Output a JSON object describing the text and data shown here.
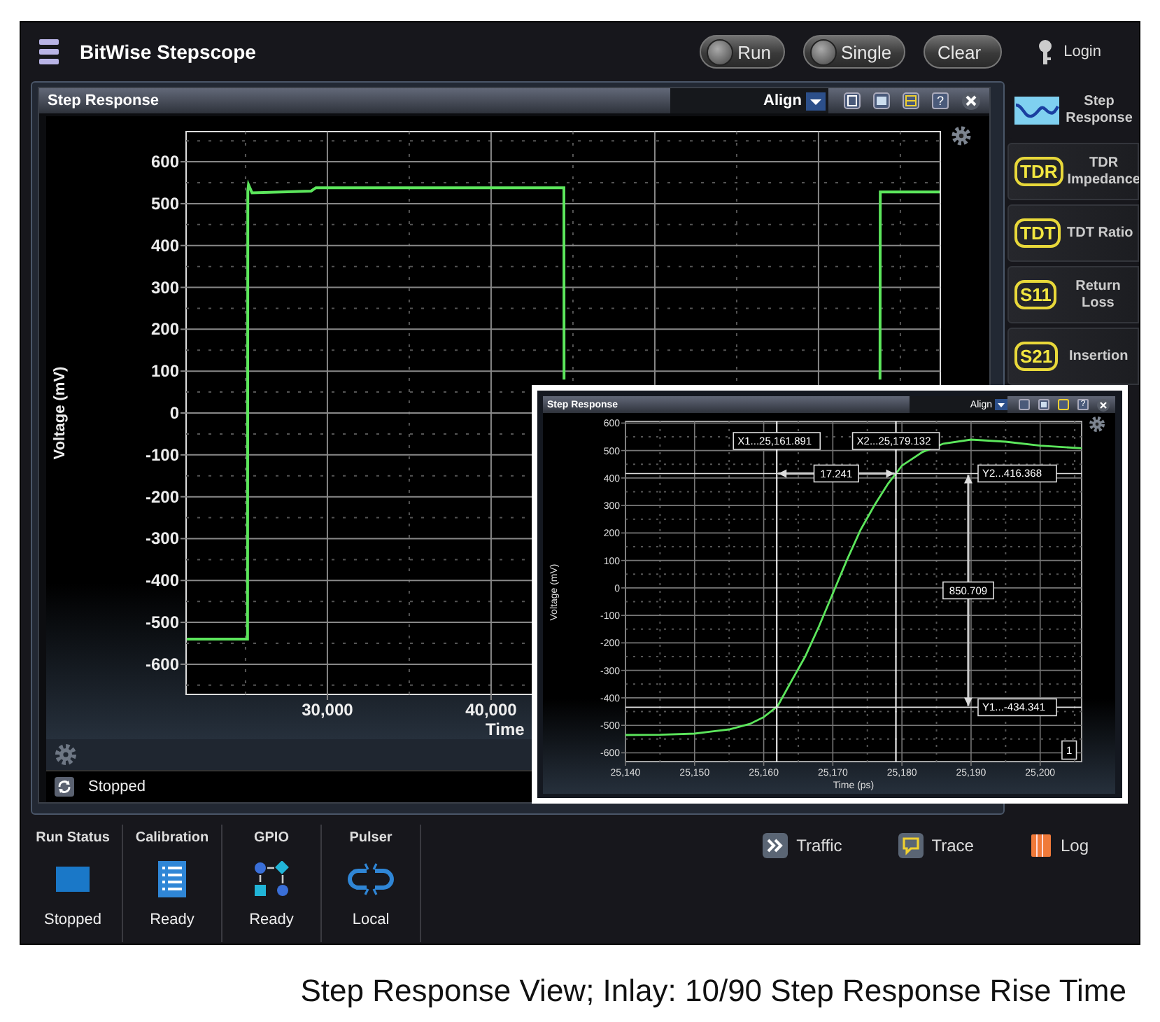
{
  "header": {
    "title": "BitWise Stepscope",
    "buttons": [
      {
        "label": "Run",
        "knob": true
      },
      {
        "label": "Single",
        "knob": true
      },
      {
        "label": "Clear",
        "knob": false
      }
    ],
    "login": "Login"
  },
  "main_window": {
    "title": "Step Response",
    "align": "Align",
    "help": "?",
    "status": "Stopped",
    "chart_data": {
      "type": "line",
      "xlabel": "Time",
      "ylabel": "Voltage (mV)",
      "grid": true,
      "x": [
        21400,
        25125,
        25140,
        25180,
        25400,
        29000,
        29300,
        44450,
        44455,
        63760,
        63770,
        67400
      ],
      "series": [
        {
          "color": "#5ce65c",
          "values": [
            -540,
            -540,
            530,
            545,
            526,
            530,
            538,
            538,
            80,
            null,
            null,
            null
          ]
        },
        {
          "color": "#5ce65c",
          "values": [
            null,
            null,
            null,
            null,
            null,
            null,
            null,
            null,
            null,
            80,
            528,
            528
          ]
        }
      ],
      "xlim": [
        21370,
        67440
      ],
      "ylim": [
        -672,
        672
      ],
      "xticks": [
        {
          "value": 30000,
          "label": "30,000"
        },
        {
          "value": 40000,
          "label": "40,000"
        }
      ],
      "yticks": [
        -600,
        -500,
        -400,
        -300,
        -200,
        -100,
        0,
        100,
        200,
        300,
        400,
        500,
        600
      ]
    }
  },
  "sidebar": {
    "items": [
      {
        "label": "Step Response",
        "kind": "waveform",
        "selected": true
      },
      {
        "label": "TDR Impedance",
        "kind": "badge",
        "badge": "TDR",
        "selected": false
      },
      {
        "label": "TDT Ratio",
        "kind": "badge",
        "badge": "TDT",
        "selected": false
      },
      {
        "label": "Return Loss",
        "kind": "badge",
        "badge": "S11",
        "selected": false
      },
      {
        "label": "Insertion",
        "kind": "badge",
        "badge": "S21",
        "selected": false
      }
    ]
  },
  "status_tiles": [
    {
      "title": "Run Status",
      "value": "Stopped",
      "kind": "run"
    },
    {
      "title": "Calibration",
      "value": "Ready",
      "kind": "calibration"
    },
    {
      "title": "GPIO",
      "value": "Ready",
      "kind": "gpio"
    },
    {
      "title": "Pulser",
      "value": "Local",
      "kind": "pulser"
    }
  ],
  "links": [
    {
      "label": "Traffic",
      "kind": "traffic"
    },
    {
      "label": "Trace",
      "kind": "trace"
    },
    {
      "label": "Log",
      "kind": "log"
    }
  ],
  "inset": {
    "title": "Step Response",
    "align": "Align",
    "help": "?",
    "chart_data": {
      "type": "line",
      "xlabel": "Time (ps)",
      "ylabel": "Voltage (mV)",
      "grid": true,
      "x": [
        25140,
        25145,
        25150,
        25155,
        25158,
        25160,
        25162,
        25164,
        25166,
        25168,
        25170,
        25172,
        25174,
        25176,
        25178,
        25180,
        25183,
        25186,
        25190,
        25195,
        25200,
        25206
      ],
      "series": [
        {
          "color": "#5ce65c",
          "values": [
            -535,
            -534,
            -530,
            -515,
            -495,
            -470,
            -430,
            -340,
            -250,
            -140,
            -20,
            100,
            210,
            300,
            380,
            445,
            495,
            525,
            540,
            532,
            518,
            508
          ]
        }
      ],
      "xlim": [
        25140,
        25206
      ],
      "ylim": [
        -632,
        606
      ],
      "xticks": [
        {
          "value": 25140,
          "label": "25,140"
        },
        {
          "value": 25150,
          "label": "25,150"
        },
        {
          "value": 25160,
          "label": "25,160"
        },
        {
          "value": 25170,
          "label": "25,170"
        },
        {
          "value": 25180,
          "label": "25,180"
        },
        {
          "value": 25190,
          "label": "25,190"
        },
        {
          "value": 25200,
          "label": "25,200"
        }
      ],
      "yticks": [
        -600,
        -500,
        -400,
        -300,
        -200,
        -100,
        0,
        100,
        200,
        300,
        400,
        500,
        600
      ],
      "ref_lines": [
        {
          "axis": "x",
          "value": 25161.891,
          "label": "X1...25,161.891"
        },
        {
          "axis": "x",
          "value": 25179.132,
          "label": "X2...25,179.132"
        },
        {
          "axis": "y",
          "value": 416.368,
          "label": "Y2...416.368"
        },
        {
          "axis": "y",
          "value": -434.341,
          "label": "Y1...-434.341"
        }
      ],
      "annotations": [
        {
          "text": "17.241",
          "x": 25170.5,
          "y": 416.368
        },
        {
          "text": "850.709",
          "x": 25189.6,
          "y": -9
        },
        {
          "text": "1",
          "x": 25204.2,
          "y": -590
        }
      ]
    }
  },
  "caption": "Step Response View; Inlay: 10/90 Step Response Rise Time"
}
